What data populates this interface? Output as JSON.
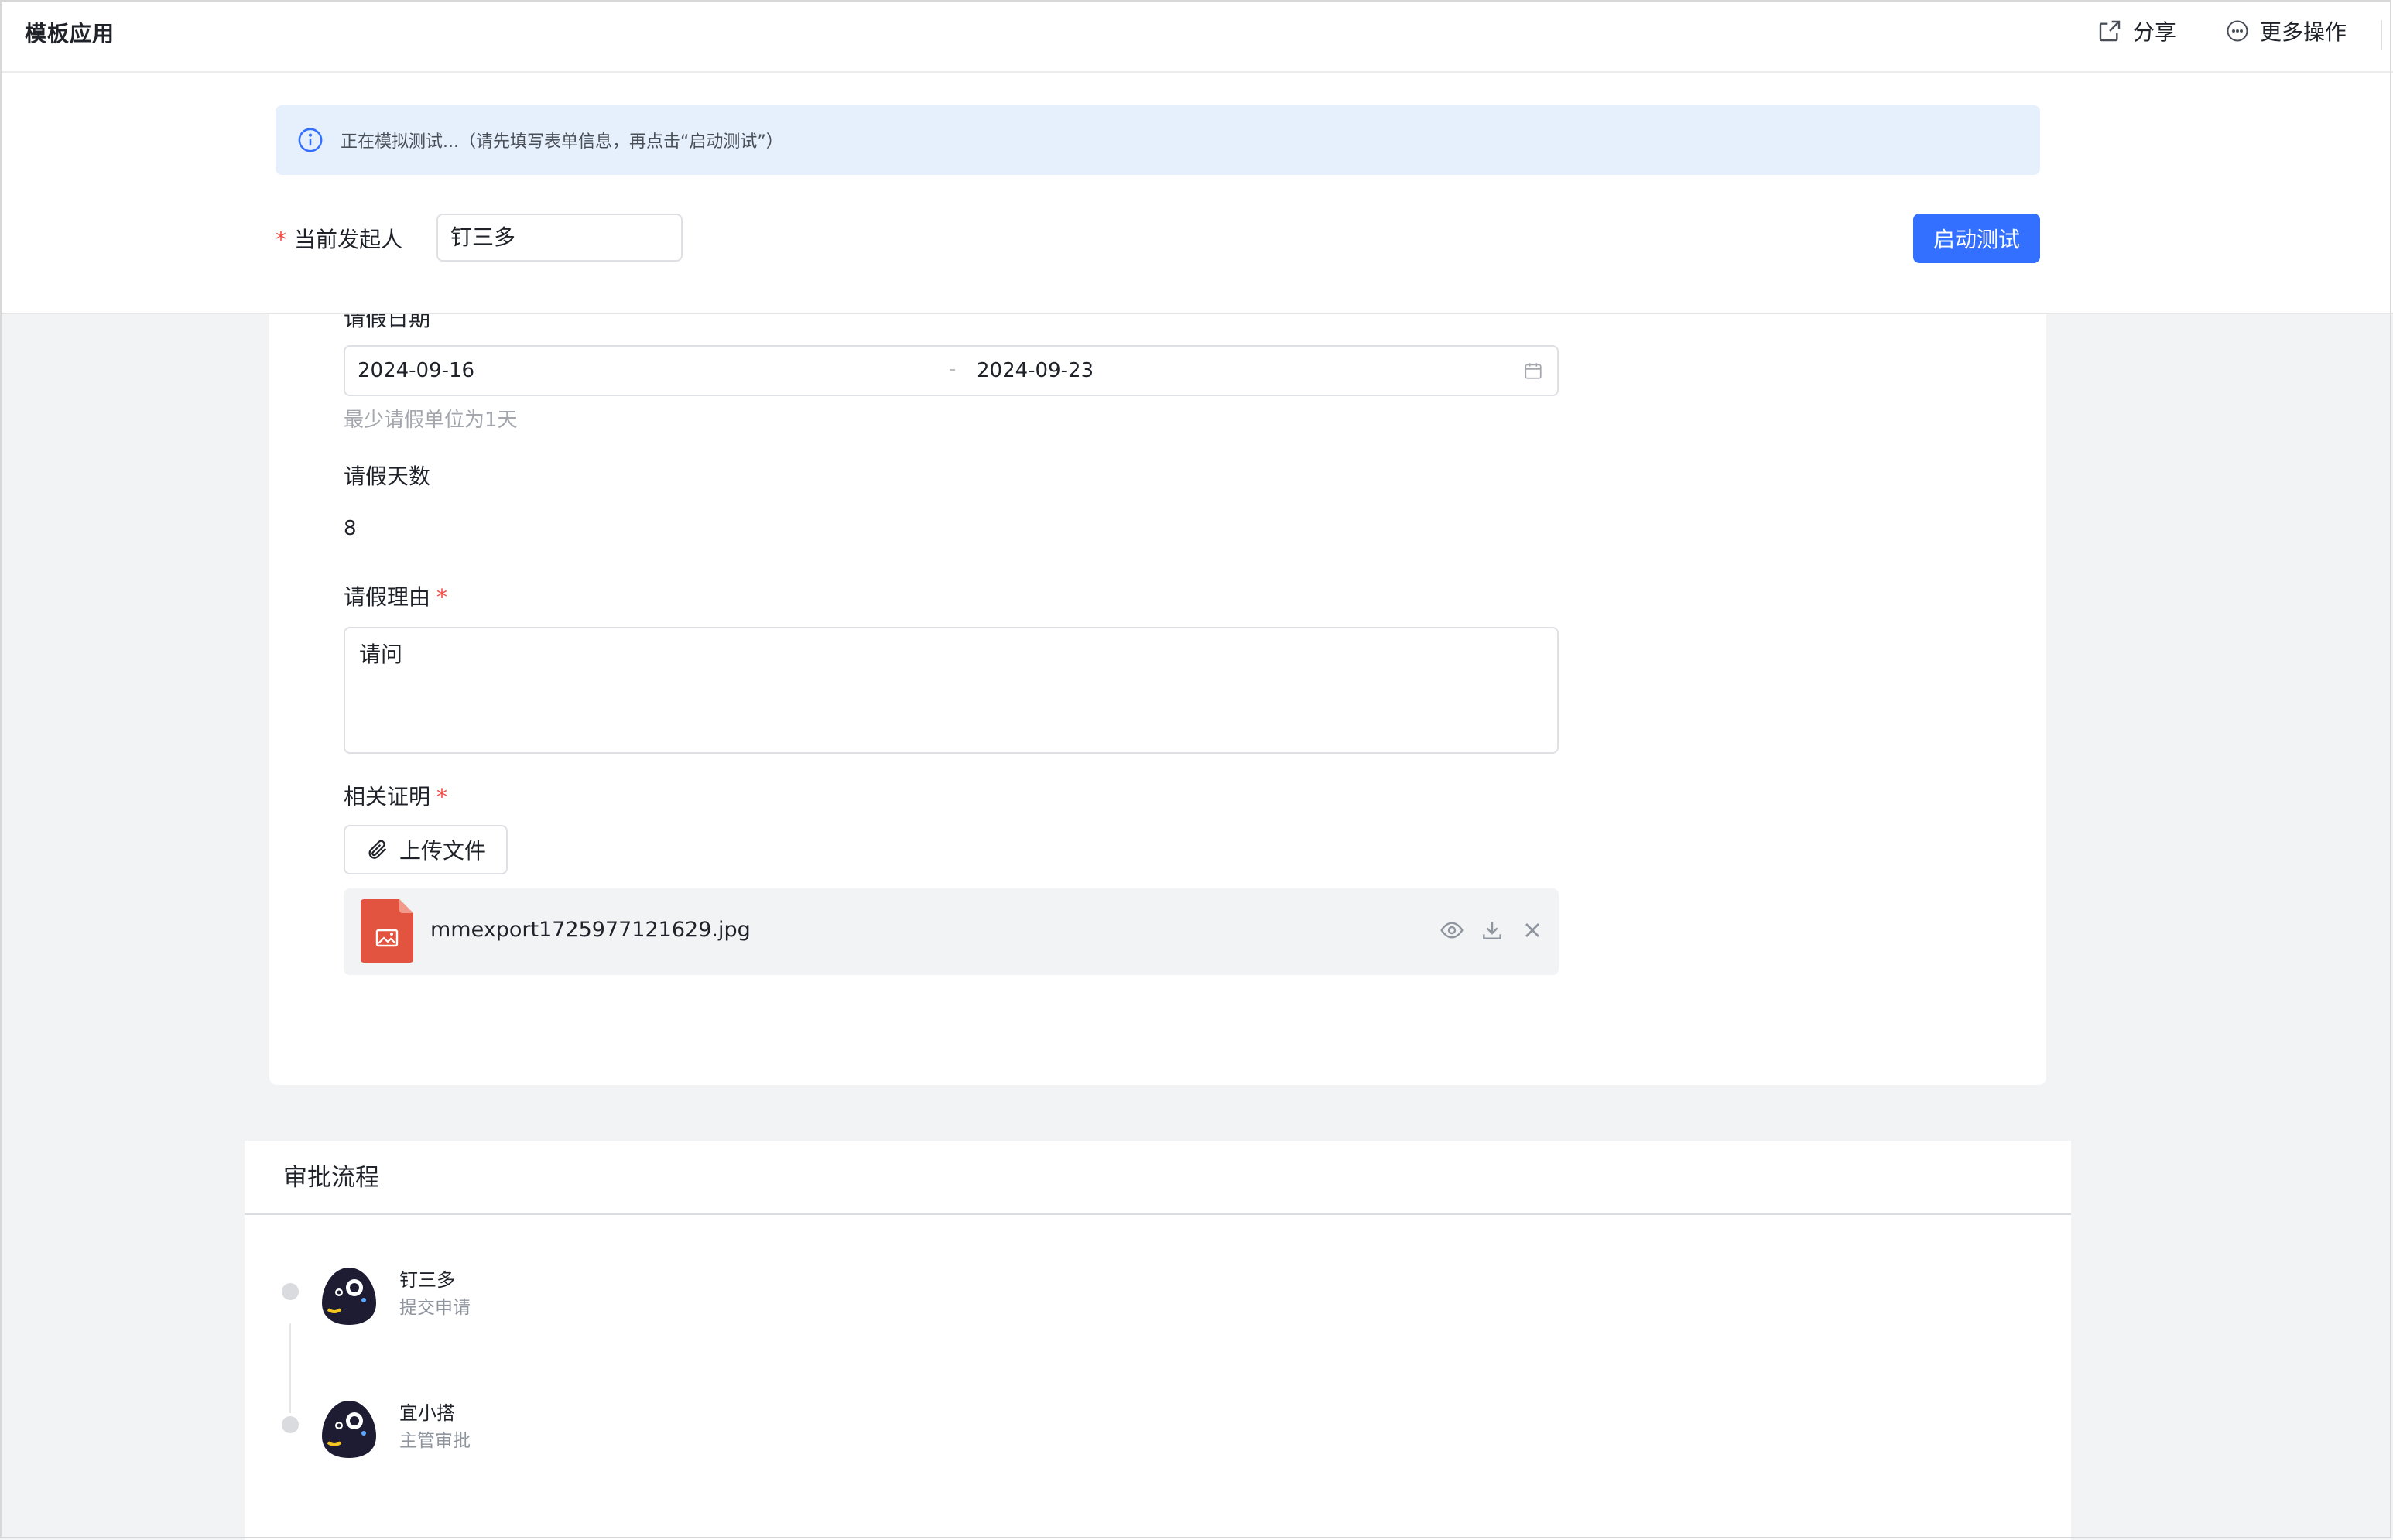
{
  "header": {
    "app_title": "模板应用",
    "share_label": "分享",
    "more_label": "更多操作"
  },
  "test_panel": {
    "info_message": "正在模拟测试...（请先填写表单信息，再点击“启动测试”）",
    "initiator_label": "当前发起人",
    "initiator_required_mark": "*",
    "initiator_value": "钉三多",
    "start_button": "启动测试"
  },
  "form": {
    "leave_date_label": "请假日期",
    "date_start": "2024-09-16",
    "date_separator": "-",
    "date_end": "2024-09-23",
    "date_hint": "最少请假单位为1天",
    "leave_days_label": "请假天数",
    "leave_days_value": "8",
    "reason_label": "请假理由",
    "reason_value": "请问",
    "proof_label": "相关证明",
    "required_mark": "*",
    "upload_button": "上传文件",
    "file_name": "mmexport1725977121629.jpg"
  },
  "approval": {
    "title": "审批流程",
    "nodes": [
      {
        "name": "钉三多",
        "role": "提交申请"
      },
      {
        "name": "宜小搭",
        "role": "主管审批"
      }
    ]
  },
  "colors": {
    "primary": "#3370ff",
    "info_bg": "#e6f0fd",
    "required": "#f54a45",
    "file_icon": "#e2543f"
  }
}
